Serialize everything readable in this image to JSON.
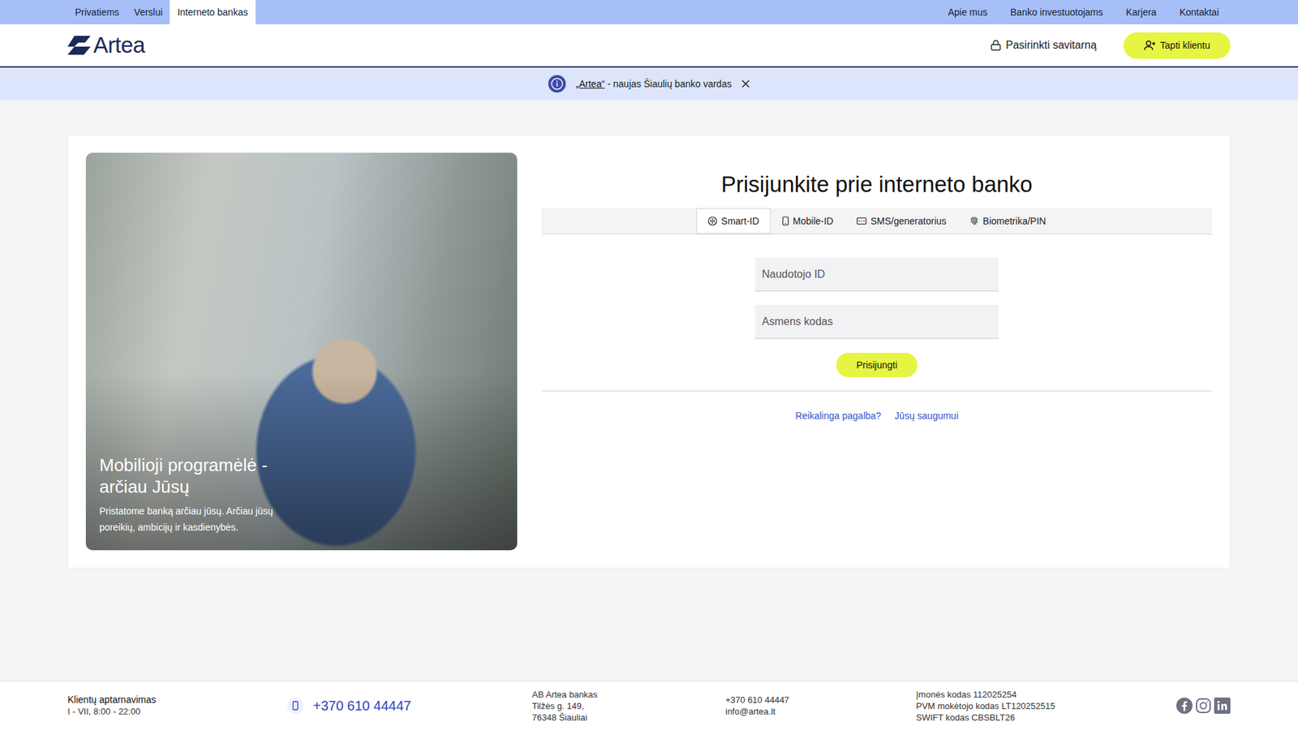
{
  "top_nav": {
    "left": [
      {
        "label": "Privatiems",
        "selected": false
      },
      {
        "label": "Verslui",
        "selected": false
      },
      {
        "label": "Interneto bankas",
        "selected": true
      }
    ],
    "right": [
      "Apie mus",
      "Banko investuotojams",
      "Karjera",
      "Kontaktai"
    ]
  },
  "header": {
    "logo": "Artea",
    "self_service": "Pasirinkti savitarną",
    "become_client": "Tapti klientu"
  },
  "banner": {
    "link": "„Artea“",
    "text": " - naujas Šiaulių banko vardas"
  },
  "promo": {
    "title": "Mobilioji programėlė - arčiau Jūsų",
    "subtitle": "Pristatome banką arčiau jūsų. Arčiau jūsų poreikių, ambicijų ir kasdienybės."
  },
  "login": {
    "title": "Prisijunkite prie interneto banko",
    "tabs": [
      {
        "label": "Smart-ID",
        "selected": true
      },
      {
        "label": "Mobile-ID",
        "selected": false
      },
      {
        "label": "SMS/generatorius",
        "selected": false
      },
      {
        "label": "Biometrika/PIN",
        "selected": false
      }
    ],
    "fields": [
      {
        "placeholder": "Naudotojo ID"
      },
      {
        "placeholder": "Asmens kodas"
      }
    ],
    "submit": "Prisijungti",
    "links": [
      "Reikalinga pagalba?",
      "Jūsų saugumui"
    ]
  },
  "footer": {
    "service_title": "Klientų aptarnavimas",
    "service_hours": "I - VII, 8:00 - 22:00",
    "phone": "+370 610 44447",
    "address": [
      "AB Artea bankas",
      "Tilžės g. 149,",
      "76348 Šiauliai"
    ],
    "contacts": [
      "+370 610 44447",
      "info@artea.lt"
    ],
    "codes": [
      "Įmonės kodas 112025254",
      "PVM mokėtojo kodas LT120252515",
      "SWIFT kodas CBSBLT26"
    ]
  }
}
